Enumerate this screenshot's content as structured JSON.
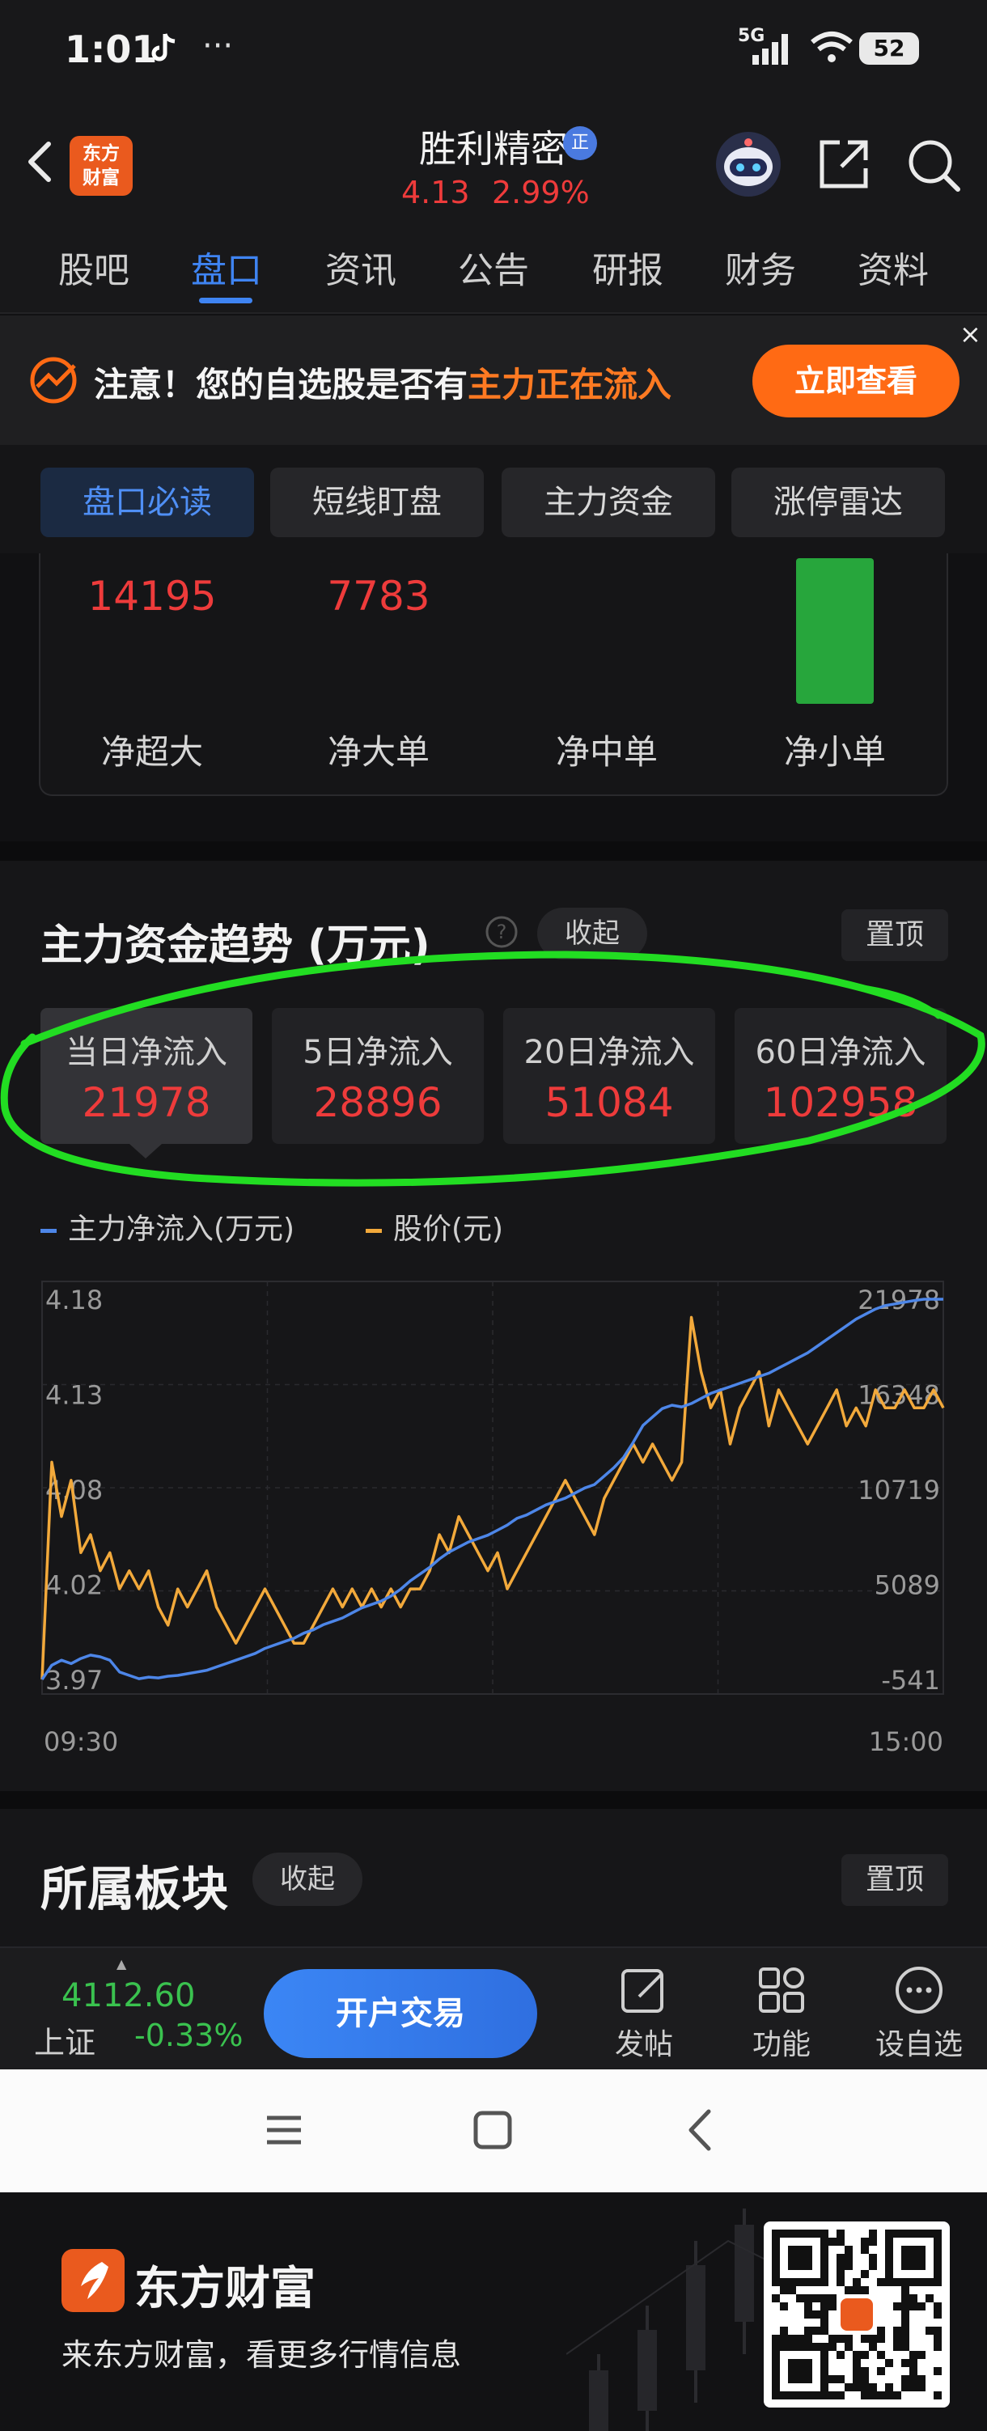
{
  "status": {
    "time": "1:01",
    "tiktok_icon": "tiktok-icon",
    "dots": "···",
    "network": "5G",
    "battery": "52"
  },
  "header": {
    "logo_line1": "东方",
    "logo_line2": "财富",
    "stock_name": "胜利精密",
    "badge": "正",
    "price": "4.13",
    "change_pct": "2.99%"
  },
  "tabs": [
    "股吧",
    "盘口",
    "资讯",
    "公告",
    "研报",
    "财务",
    "资料"
  ],
  "active_tab": "盘口",
  "notice": {
    "text_part1": "注意！您的自选股是否有",
    "text_highlight": "主力正在流入",
    "button": "立即查看",
    "close": "×"
  },
  "subtabs": [
    "盘口必读",
    "短线盯盘",
    "主力资金",
    "涨停雷达"
  ],
  "flow": {
    "values": [
      "14195",
      "7783"
    ],
    "labels": [
      "净超大",
      "净大单",
      "净中单",
      "净小单"
    ]
  },
  "trend": {
    "title": "主力资金趋势 (万元)",
    "collapse": "收起",
    "pin": "置顶",
    "periods": [
      {
        "label": "当日净流入",
        "value": "21978"
      },
      {
        "label": "5日净流入",
        "value": "28896"
      },
      {
        "label": "20日净流入",
        "value": "51084"
      },
      {
        "label": "60日净流入",
        "value": "102958"
      }
    ],
    "legend_flow": "主力净流入(万元)",
    "legend_price": "股价(元)"
  },
  "chart_data": {
    "type": "line",
    "x_start": "09:30",
    "x_end": "15:00",
    "left_ticks": [
      "4.18",
      "4.13",
      "4.08",
      "4.02",
      "3.97"
    ],
    "right_ticks": [
      "21978",
      "16348",
      "10719",
      "5089",
      "-541"
    ],
    "left_ylim": [
      3.97,
      4.18
    ],
    "right_ylim": [
      -541,
      21978
    ],
    "grid": true,
    "series": [
      {
        "name": "股价(元)",
        "axis": "left",
        "color": "#f2a93b",
        "values": [
          3.97,
          4.09,
          4.06,
          4.08,
          4.04,
          4.05,
          4.03,
          4.04,
          4.02,
          4.03,
          4.02,
          4.03,
          4.01,
          4.0,
          4.02,
          4.01,
          4.02,
          4.03,
          4.01,
          4.0,
          3.99,
          4.0,
          4.01,
          4.02,
          4.01,
          4.0,
          3.99,
          3.99,
          4.0,
          4.01,
          4.02,
          4.01,
          4.02,
          4.01,
          4.02,
          4.01,
          4.02,
          4.01,
          4.02,
          4.02,
          4.03,
          4.05,
          4.04,
          4.06,
          4.05,
          4.04,
          4.03,
          4.04,
          4.02,
          4.03,
          4.04,
          4.05,
          4.06,
          4.07,
          4.08,
          4.07,
          4.06,
          4.05,
          4.07,
          4.08,
          4.09,
          4.1,
          4.09,
          4.1,
          4.09,
          4.08,
          4.09,
          4.17,
          4.14,
          4.12,
          4.13,
          4.1,
          4.12,
          4.13,
          4.14,
          4.11,
          4.13,
          4.12,
          4.11,
          4.1,
          4.11,
          4.12,
          4.13,
          4.11,
          4.12,
          4.11,
          4.13,
          4.12,
          4.12,
          4.13,
          4.12,
          4.12,
          4.13,
          4.12
        ]
      },
      {
        "name": "主力净流入(万元)",
        "axis": "right",
        "color": "#4d86e8",
        "values": [
          -541,
          300,
          600,
          400,
          700,
          900,
          800,
          600,
          -100,
          -300,
          -500,
          -400,
          -450,
          -350,
          -300,
          -200,
          -100,
          0,
          200,
          400,
          600,
          800,
          1000,
          1300,
          1500,
          1700,
          1900,
          2200,
          2400,
          2700,
          2900,
          3100,
          3400,
          3700,
          3900,
          4100,
          4400,
          4800,
          5300,
          5700,
          6100,
          6600,
          7000,
          7300,
          7600,
          7800,
          8000,
          8300,
          8600,
          9000,
          9200,
          9500,
          9800,
          10000,
          10200,
          10500,
          10800,
          11000,
          11500,
          12000,
          12600,
          13500,
          14500,
          15000,
          15500,
          15700,
          15600,
          15800,
          16100,
          16400,
          16600,
          16800,
          17000,
          17200,
          17400,
          17600,
          17900,
          18200,
          18500,
          18800,
          19200,
          19600,
          20000,
          20400,
          20800,
          21100,
          21400,
          21600,
          21700,
          21800,
          21900,
          21978,
          21978,
          21978
        ]
      }
    ]
  },
  "sector": {
    "title": "所属板块",
    "collapse": "收起",
    "pin": "置顶"
  },
  "bottombar": {
    "index_value": "4112.60",
    "index_name": "上证",
    "index_pct": "-0.33%",
    "trade_button": "开户交易",
    "items": [
      "发帖",
      "功能",
      "设自选"
    ]
  },
  "footer": {
    "brand": "东方财富",
    "slogan": "来东方财富，看更多行情信息"
  },
  "colors": {
    "accent": "#3f84f2",
    "up": "#ee3b3b",
    "down": "#3ac24f",
    "orange": "#ff6a14",
    "highlight_ring": "#22dd22"
  }
}
